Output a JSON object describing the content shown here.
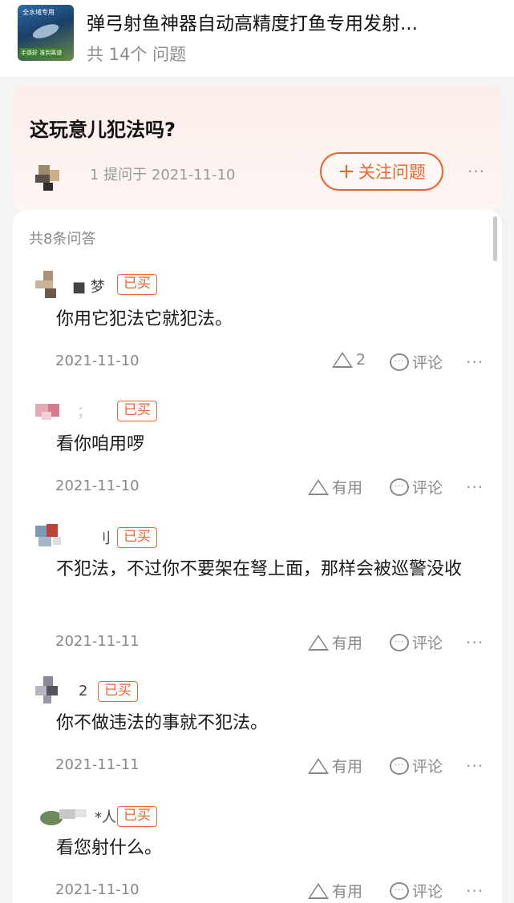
{
  "product": {
    "title": "弹弓射鱼神器自动高精度打鱼专用发射...",
    "question_count": "共 14个 问题",
    "thumb_text_top": "全水域专用",
    "thumb_text_bottom": "手感好 准到离谱"
  },
  "question": {
    "title": "这玩意儿犯法吗?",
    "meta": "1 提问于 2021-11-10",
    "follow_label": "关注问题",
    "follow_icon": "plus-icon",
    "more": "···"
  },
  "answers_header": "共8条问答",
  "labels": {
    "bought": "已买",
    "useful": "有用",
    "comment": "评论",
    "more": "···"
  },
  "answers": [
    {
      "user": "■ 梦",
      "text": "你用它犯法它就犯法。",
      "date": "2021-11-10",
      "likes": "2"
    },
    {
      "user": "；",
      "text": "看你咱用啰",
      "date": "2021-11-10",
      "likes": ""
    },
    {
      "user": "刂",
      "text": "不犯法，不过你不要架在弩上面，那样会被巡警没收",
      "date": "2021-11-11",
      "likes": ""
    },
    {
      "user": "2",
      "text": "你不做违法的事就不犯法。",
      "date": "2021-11-11",
      "likes": ""
    },
    {
      "user": "*人",
      "text": "看您射什么。",
      "date": "2021-11-10",
      "likes": ""
    }
  ],
  "colors": {
    "accent": "#e8652d",
    "muted": "#888888",
    "question_bg": "#fbeeea"
  }
}
